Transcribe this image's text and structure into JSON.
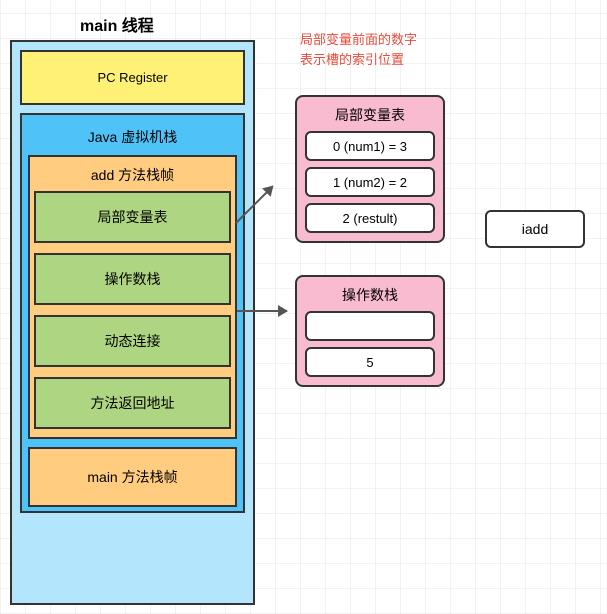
{
  "title": "main 线程",
  "note": {
    "line1": "局部变量前面的数字",
    "line2": "表示槽的索引位置"
  },
  "pc_register": "PC Register",
  "vm_stack_title": "Java 虚拟机栈",
  "add_frame": {
    "title": "add 方法栈帧",
    "items": {
      "local_vars": "局部变量表",
      "operand_stack": "操作数栈",
      "dynamic_link": "动态连接",
      "return_addr": "方法返回地址"
    }
  },
  "main_frame": "main 方法栈帧",
  "local_vars_detail": {
    "title": "局部变量表",
    "rows": [
      "0 (num1) = 3",
      "1 (num2) = 2",
      "2 (restult)"
    ]
  },
  "operand_stack_detail": {
    "title": "操作数栈",
    "rows": [
      "",
      "5"
    ]
  },
  "instruction": "iadd",
  "chart_data": {
    "type": "diagram",
    "thread": "main",
    "components": [
      "PC Register",
      "Java VM Stack"
    ],
    "vm_stack_frames": [
      "add 方法栈帧",
      "main 方法栈帧"
    ],
    "add_frame_parts": [
      "局部变量表",
      "操作数栈",
      "动态连接",
      "方法返回地址"
    ],
    "local_variable_table": [
      {
        "slot": 0,
        "name": "num1",
        "value": 3
      },
      {
        "slot": 1,
        "name": "num2",
        "value": 2
      },
      {
        "slot": 2,
        "name": "restult",
        "value": null
      }
    ],
    "operand_stack": [
      null,
      5
    ],
    "current_instruction": "iadd",
    "arrows": [
      {
        "from": "局部变量表 (frame)",
        "to": "局部变量表 (detail)"
      },
      {
        "from": "操作数栈 (frame)",
        "to": "操作数栈 (detail)"
      }
    ],
    "note": "局部变量前面的数字表示槽的索引位置"
  }
}
